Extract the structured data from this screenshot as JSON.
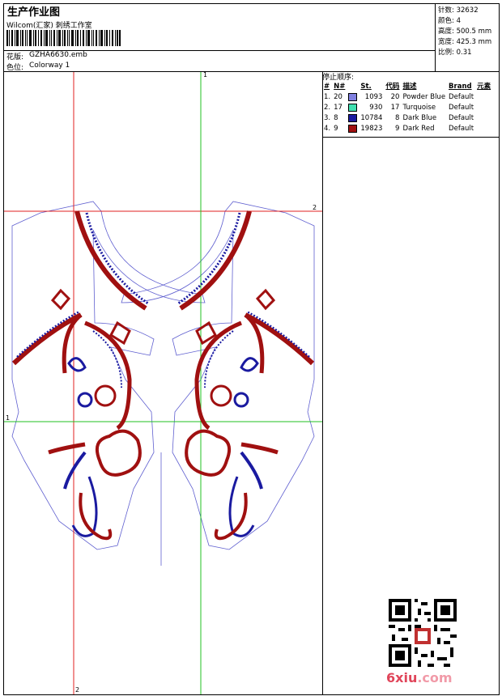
{
  "header": {
    "title": "生产作业图",
    "studio": "Wilcom(汇家) 刺绣工作室",
    "design_label": "花版:",
    "design_value": "GZHA6630.emb",
    "colorway_label": "色位:",
    "colorway_value": "Colorway 1"
  },
  "info": {
    "stitches_label": "针数:",
    "stitches_value": "32632",
    "colors_label": "颜色:",
    "colors_value": "4",
    "height_label": "高度:",
    "height_value": "500.5 mm",
    "width_label": "宽度:",
    "width_value": "425.3 mm",
    "scale_label": "比例:",
    "scale_value": "0.31"
  },
  "stop_sequence": {
    "title": "停止顺序:",
    "columns": [
      "#",
      "N#",
      "",
      "St.",
      "代码",
      "描述",
      "Brand",
      "元素"
    ],
    "rows": [
      {
        "num": "1.",
        "n": "20",
        "swatch": "#8080e0",
        "st": "1093",
        "code": "20",
        "desc": "Powder Blue",
        "brand": "Default"
      },
      {
        "num": "2.",
        "n": "17",
        "swatch": "#40e0b0",
        "st": "930",
        "code": "17",
        "desc": "Turquoise",
        "brand": "Default"
      },
      {
        "num": "3.",
        "n": "8",
        "swatch": "#1a1aa0",
        "st": "10784",
        "code": "8",
        "desc": "Dark Blue",
        "brand": "Default"
      },
      {
        "num": "4.",
        "n": "9",
        "swatch": "#a01010",
        "st": "19823",
        "code": "9",
        "desc": "Dark Red",
        "brand": "Default"
      }
    ]
  },
  "guides": {
    "top_marker": "1",
    "right_marker": "2",
    "left_marker": "1",
    "bottom_marker": "2"
  },
  "watermark": {
    "main": "6xiu",
    "suffix": ".com"
  },
  "colors": {
    "dark_red": "#a01010",
    "dark_blue": "#1a1aa0",
    "guide_red": "#e02020",
    "guide_green": "#20c020",
    "outline": "#6060d0"
  }
}
